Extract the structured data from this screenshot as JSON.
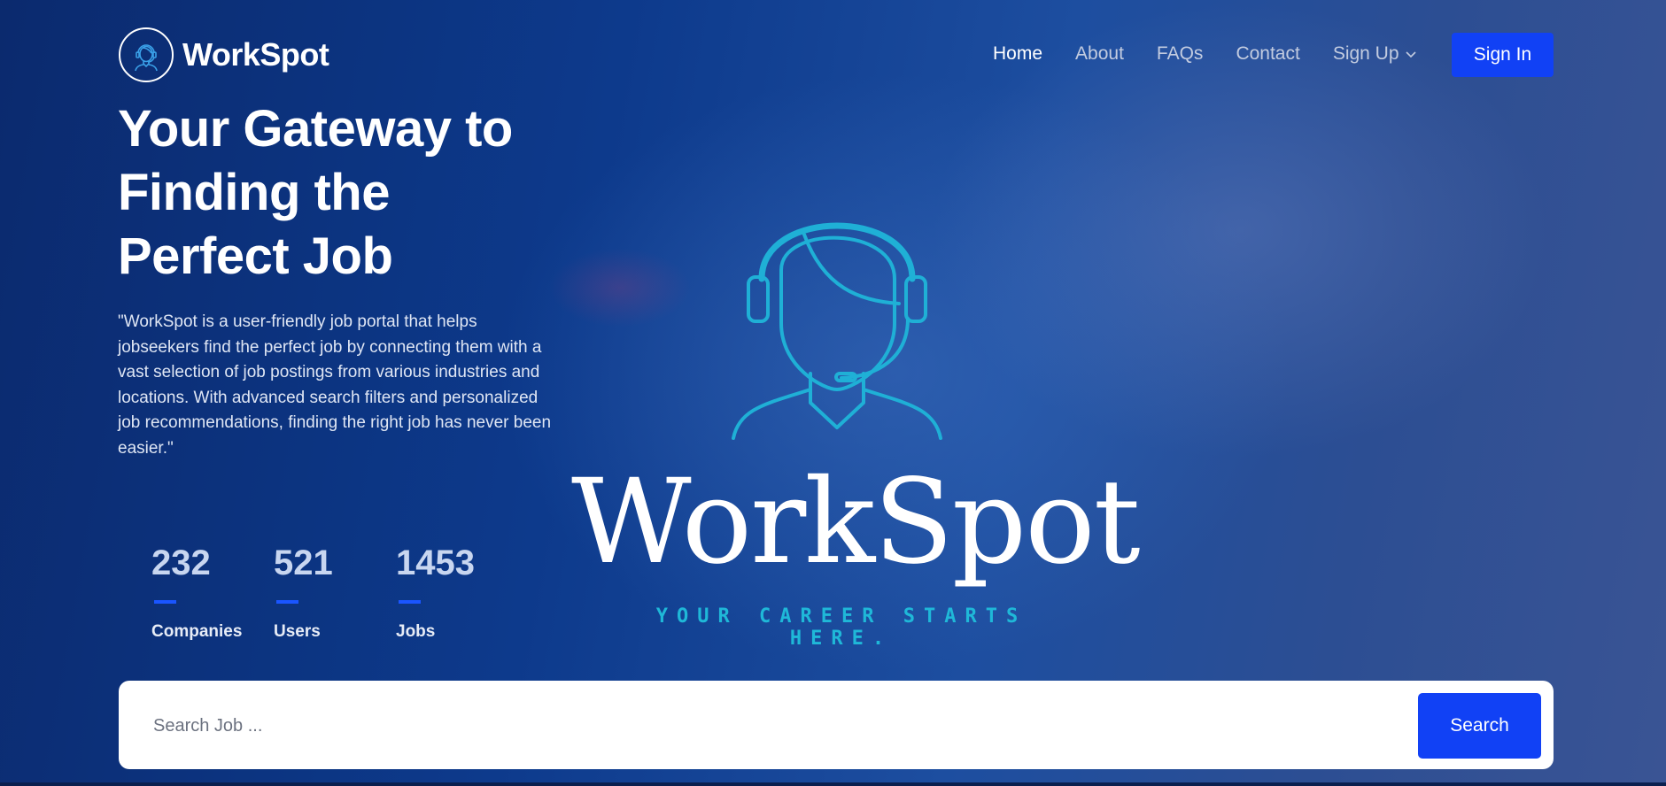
{
  "brand": {
    "name": "WorkSpot",
    "logo_icon": "headset-person-icon"
  },
  "nav": {
    "items": [
      {
        "label": "Home",
        "active": true
      },
      {
        "label": "About",
        "active": false
      },
      {
        "label": "FAQs",
        "active": false
      },
      {
        "label": "Contact",
        "active": false
      },
      {
        "label": "Sign Up",
        "active": false,
        "dropdown": true
      }
    ],
    "signin_label": "Sign In"
  },
  "hero": {
    "title_line1": "Your Gateway to",
    "title_line2": "Finding the",
    "title_line3": "Perfect Job",
    "description": "\"WorkSpot is a user-friendly job portal that helps jobseekers find the perfect job by connecting them with a vast selection of job postings from various industries and locations. With advanced search filters and personalized job recommendations, finding the right job has never been easier.\""
  },
  "stats": [
    {
      "value": "232",
      "label": "Companies"
    },
    {
      "value": "521",
      "label": "Users"
    },
    {
      "value": "1453",
      "label": "Jobs"
    }
  ],
  "center_logo": {
    "word": "WorkSpot",
    "tagline": "YOUR CAREER STARTS HERE.",
    "icon": "headset-person-icon"
  },
  "search": {
    "placeholder": "Search Job ...",
    "button_label": "Search"
  },
  "colors": {
    "accent": "#1141f5",
    "teal": "#1fb8d8",
    "background": "#0d3a8c"
  }
}
